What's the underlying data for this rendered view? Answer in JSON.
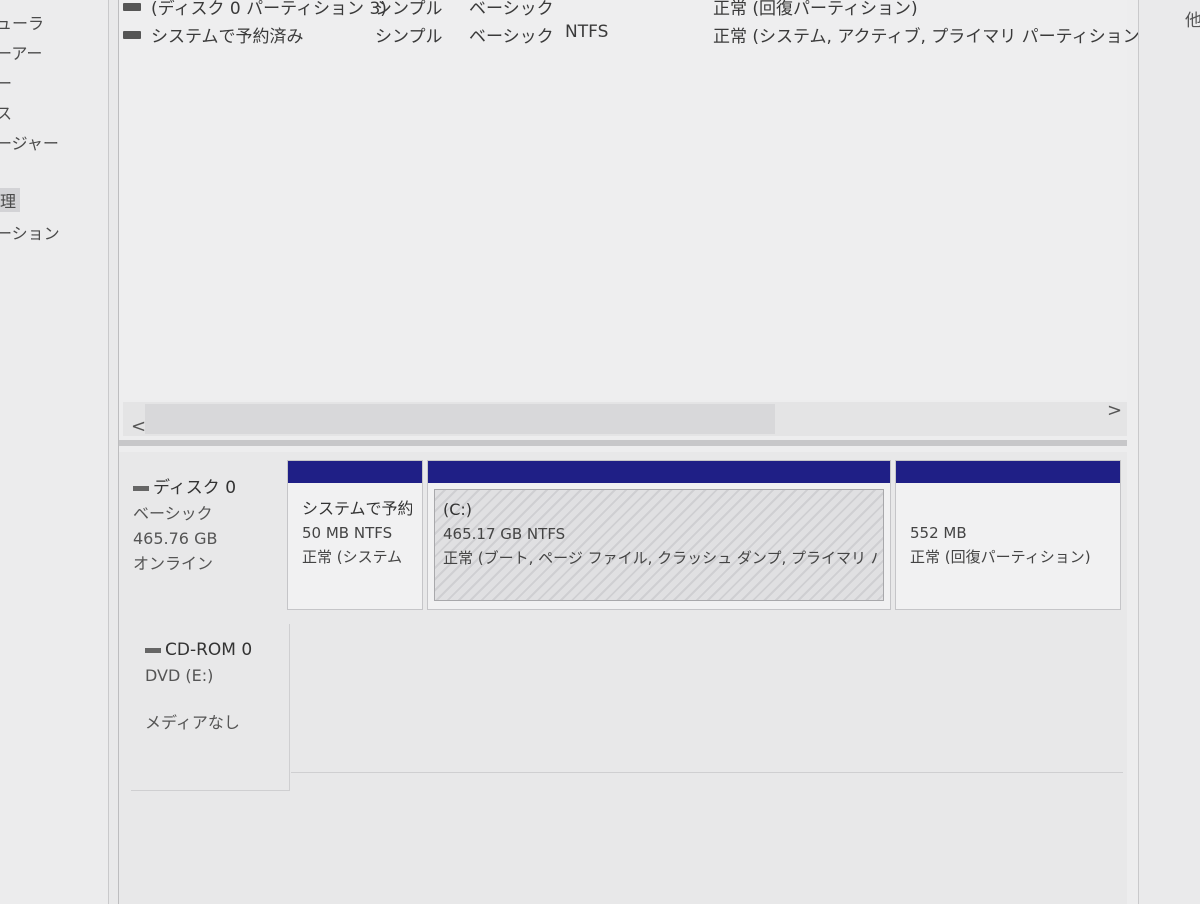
{
  "nav": {
    "items": [
      "ューラ",
      "ーアー",
      "ー",
      "ス",
      "ージャー",
      "理",
      "ーション"
    ],
    "selected_index": 5
  },
  "volume_list": {
    "rows": [
      {
        "name": "(ディスク 0 パーティション 3)",
        "layout": "シンプル",
        "type": "ベーシック",
        "fs": "",
        "status": "正常 (回復パーティション)"
      },
      {
        "name": "システムで予約済み",
        "layout": "シンプル",
        "type": "ベーシック",
        "fs": "NTFS",
        "status": "正常 (システム, アクティブ, プライマリ パーティション)"
      }
    ]
  },
  "scrollbar": {
    "left_arrow": "<",
    "right_arrow": ">"
  },
  "disks": [
    {
      "name": "ディスク 0",
      "type": "ベーシック",
      "size": "465.76 GB",
      "state": "オンライン",
      "partitions": [
        {
          "name": "システムで予約",
          "size_fs": "50 MB NTFS",
          "status": "正常 (システム"
        },
        {
          "name": "(C:)",
          "size_fs": "465.17 GB NTFS",
          "status": "正常 (ブート, ページ ファイル, クラッシュ ダンプ, プライマリ パ"
        },
        {
          "name": "",
          "size_fs": "552 MB",
          "status": "正常 (回復パーティション)"
        }
      ]
    }
  ],
  "cdrom": {
    "name": "CD-ROM 0",
    "drive": "DVD (E:)",
    "state": "メディアなし"
  },
  "right_pane": {
    "label": "他"
  },
  "colors": {
    "partition_bar": "#1f1f86",
    "background": "#ededee"
  }
}
